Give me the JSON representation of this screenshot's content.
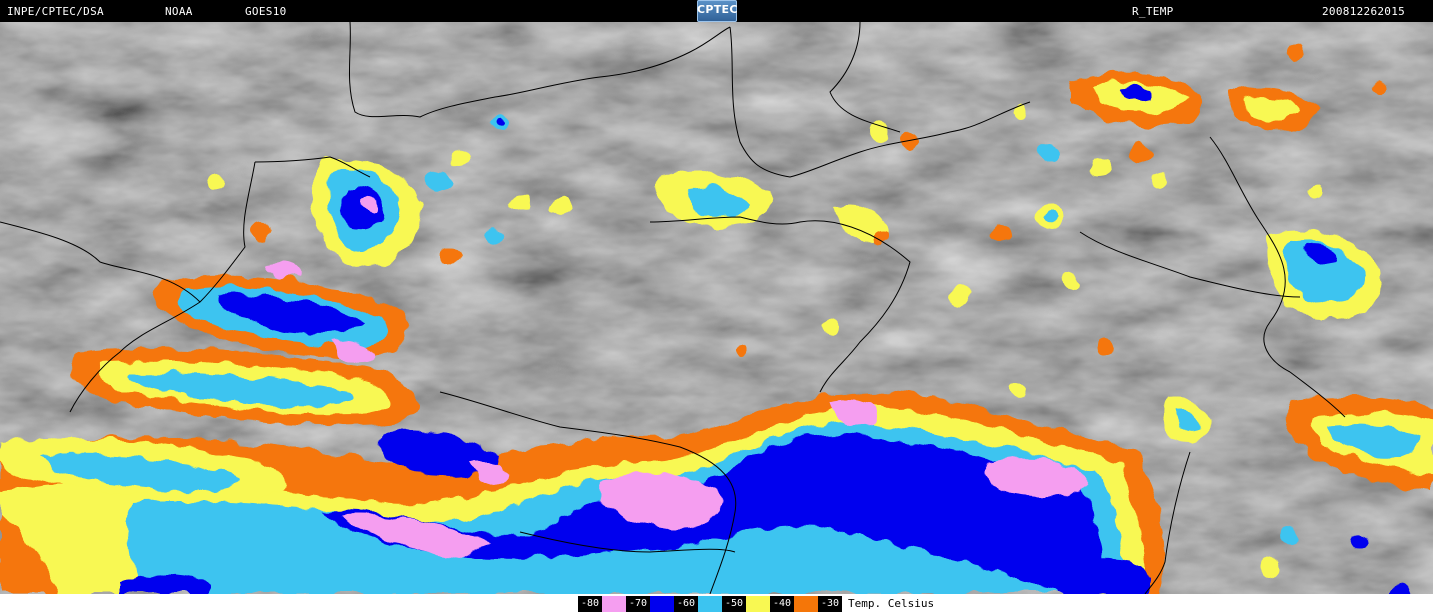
{
  "header": {
    "source": "INPE/CPTEC/DSA",
    "agency": "NOAA",
    "satellite": "GOES10",
    "logo_text": "CPTEC",
    "product": "R_TEMP",
    "datetime": "200812262015"
  },
  "legend": {
    "items": [
      {
        "label": "-80",
        "color": "#f59ef0"
      },
      {
        "label": "-70",
        "color": "#0000ee"
      },
      {
        "label": "-60",
        "color": "#3cc4f0"
      },
      {
        "label": "-50",
        "color": "#f8f852"
      },
      {
        "label": "-40",
        "color": "#f57608"
      },
      {
        "label": "-30",
        "color": ""
      }
    ],
    "unit_label": "Temp. Celsius"
  }
}
